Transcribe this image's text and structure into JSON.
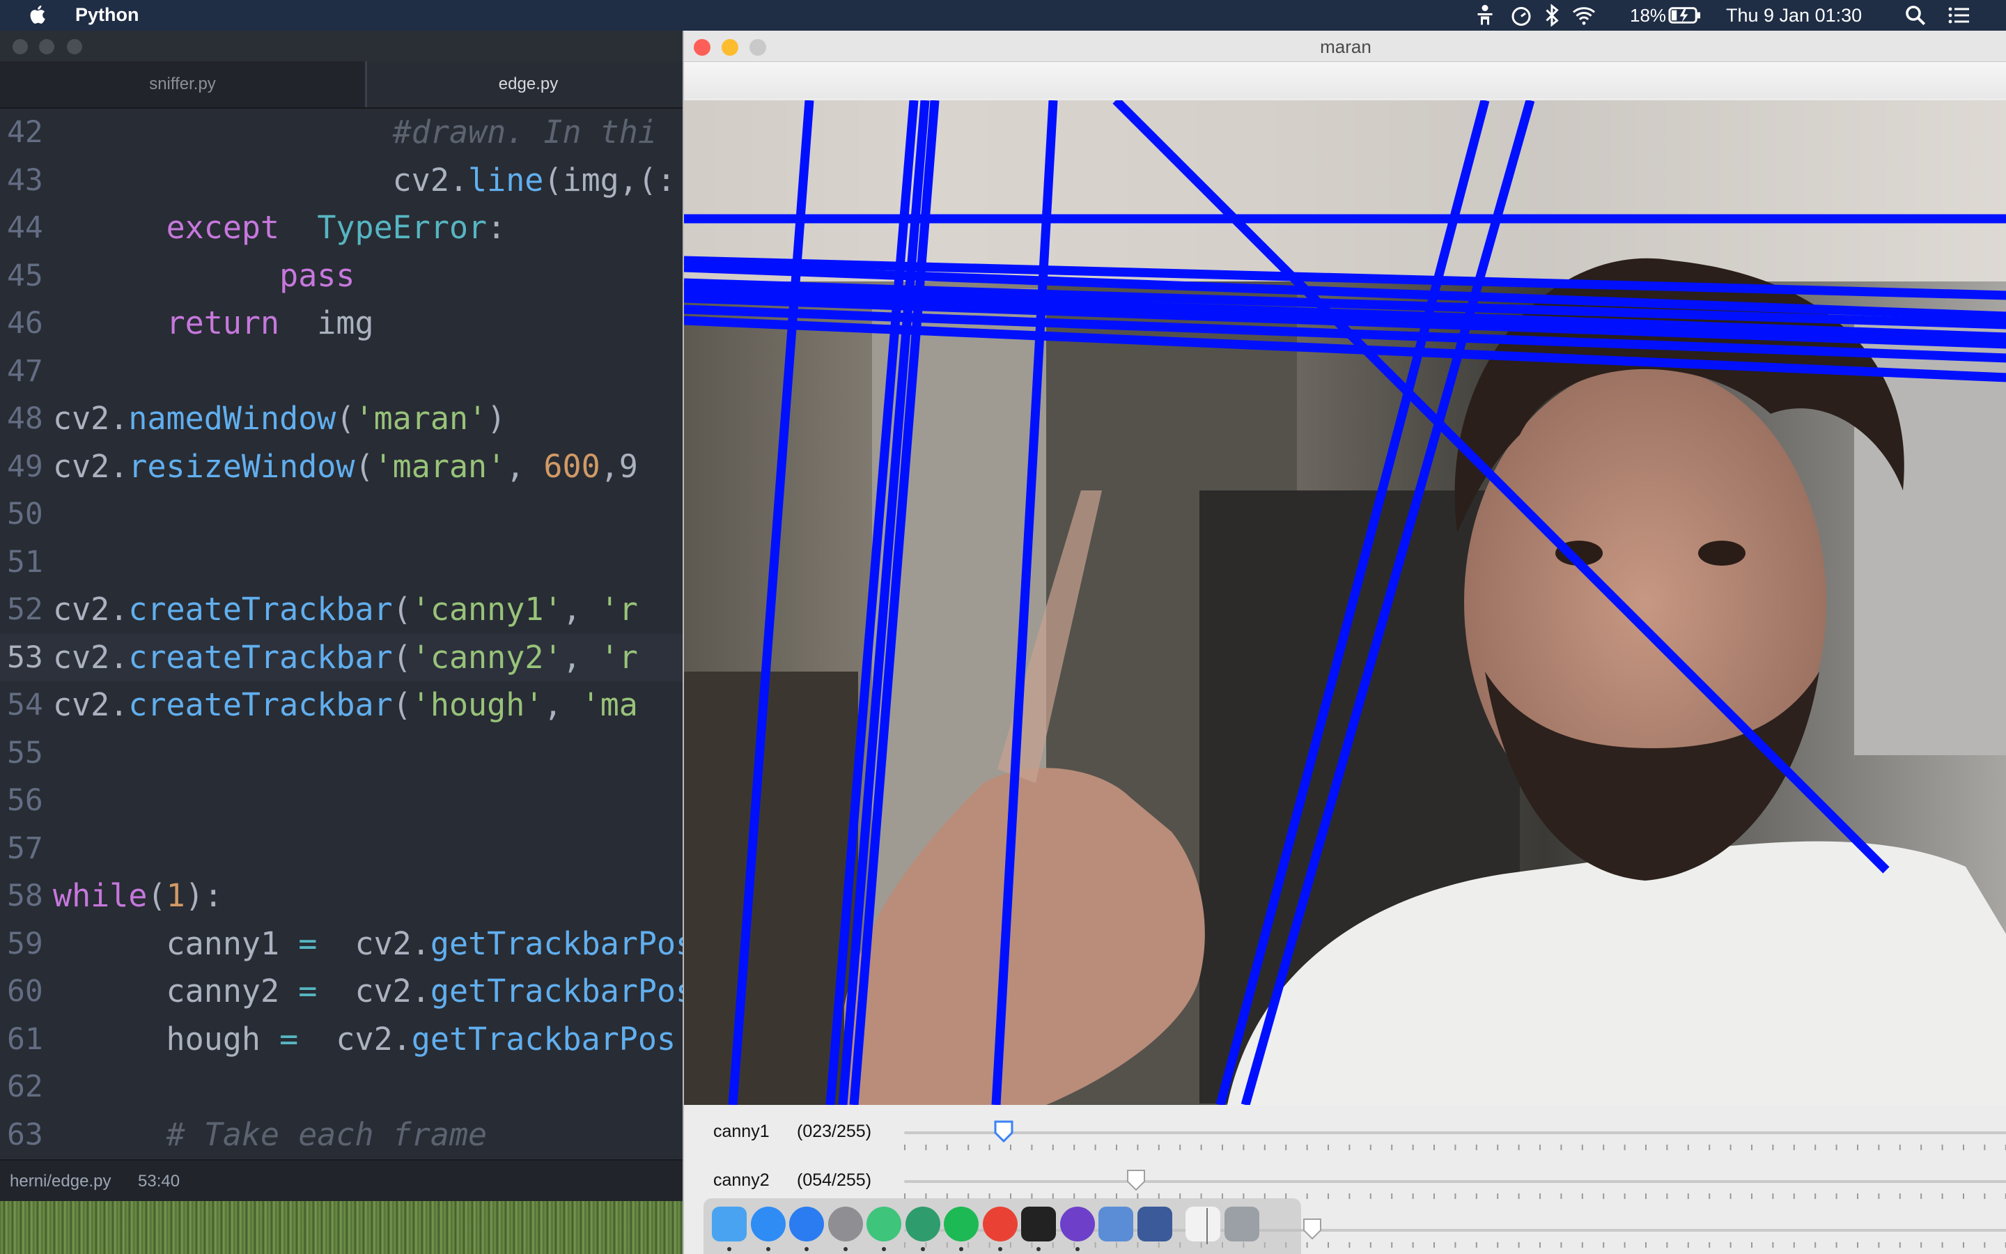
{
  "menubar": {
    "app_name": "Python",
    "battery": "18%",
    "clock": "Thu 9 Jan  01:30"
  },
  "editor": {
    "tabs": [
      {
        "label": "sniffer.py",
        "active": false
      },
      {
        "label": "edge.py",
        "active": true
      }
    ],
    "lines": [
      {
        "num": "42",
        "segments": [
          {
            "t": "         "
          },
          {
            "t": "#drawn. In thi",
            "c": "cm"
          }
        ]
      },
      {
        "num": "43",
        "segments": [
          {
            "t": "         cv2."
          },
          {
            "t": "line",
            "c": "fn"
          },
          {
            "t": "(img,(:"
          }
        ]
      },
      {
        "num": "44",
        "segments": [
          {
            "t": "   "
          },
          {
            "t": "except",
            "c": "kw"
          },
          {
            "t": " "
          },
          {
            "t": "TypeError",
            "c": "ty"
          },
          {
            "t": ":"
          }
        ]
      },
      {
        "num": "45",
        "segments": [
          {
            "t": "      "
          },
          {
            "t": "pass",
            "c": "kw"
          }
        ]
      },
      {
        "num": "46",
        "segments": [
          {
            "t": "   "
          },
          {
            "t": "return",
            "c": "kw"
          },
          {
            "t": " img"
          }
        ]
      },
      {
        "num": "47",
        "segments": []
      },
      {
        "num": "48",
        "segments": [
          {
            "t": "cv2."
          },
          {
            "t": "namedWindow",
            "c": "fn"
          },
          {
            "t": "("
          },
          {
            "t": "'maran'",
            "c": "st"
          },
          {
            "t": ")"
          }
        ]
      },
      {
        "num": "49",
        "segments": [
          {
            "t": "cv2."
          },
          {
            "t": "resizeWindow",
            "c": "fn"
          },
          {
            "t": "("
          },
          {
            "t": "'maran'",
            "c": "st"
          },
          {
            "t": ", "
          },
          {
            "t": "600",
            "c": "nm"
          },
          {
            "t": ",9"
          }
        ]
      },
      {
        "num": "50",
        "segments": []
      },
      {
        "num": "51",
        "segments": []
      },
      {
        "num": "52",
        "segments": [
          {
            "t": "cv2."
          },
          {
            "t": "createTrackbar",
            "c": "fn"
          },
          {
            "t": "("
          },
          {
            "t": "'canny1'",
            "c": "st"
          },
          {
            "t": ", "
          },
          {
            "t": "'r",
            "c": "st"
          }
        ]
      },
      {
        "num": "53",
        "segments": [
          {
            "t": "cv2."
          },
          {
            "t": "createTrackbar",
            "c": "fn"
          },
          {
            "t": "("
          },
          {
            "t": "'canny2'",
            "c": "st"
          },
          {
            "t": ", "
          },
          {
            "t": "'r",
            "c": "st"
          }
        ]
      },
      {
        "num": "54",
        "segments": [
          {
            "t": "cv2."
          },
          {
            "t": "createTrackbar",
            "c": "fn"
          },
          {
            "t": "("
          },
          {
            "t": "'hough'",
            "c": "st"
          },
          {
            "t": ", "
          },
          {
            "t": "'ma",
            "c": "st"
          }
        ]
      },
      {
        "num": "55",
        "segments": []
      },
      {
        "num": "56",
        "segments": []
      },
      {
        "num": "57",
        "segments": []
      },
      {
        "num": "58",
        "segments": [
          {
            "t": "while",
            "c": "kw"
          },
          {
            "t": "("
          },
          {
            "t": "1",
            "c": "nm"
          },
          {
            "t": "):"
          }
        ]
      },
      {
        "num": "59",
        "segments": [
          {
            "t": "   canny1 "
          },
          {
            "t": "=",
            "c": "op"
          },
          {
            "t": " cv2."
          },
          {
            "t": "getTrackbarPos",
            "c": "fn"
          }
        ]
      },
      {
        "num": "60",
        "segments": [
          {
            "t": "   canny2 "
          },
          {
            "t": "=",
            "c": "op"
          },
          {
            "t": " cv2."
          },
          {
            "t": "getTrackbarPos",
            "c": "fn"
          }
        ]
      },
      {
        "num": "61",
        "segments": [
          {
            "t": "   hough "
          },
          {
            "t": "=",
            "c": "op"
          },
          {
            "t": " cv2."
          },
          {
            "t": "getTrackbarPos",
            "c": "fn"
          }
        ]
      },
      {
        "num": "62",
        "segments": []
      },
      {
        "num": "63",
        "segments": [
          {
            "t": "   "
          },
          {
            "t": "# Take each frame",
            "c": "cm"
          }
        ]
      }
    ],
    "current_line": "53",
    "status_path": "herni/edge.py",
    "status_pos": "53:40"
  },
  "cv_window": {
    "title": "maran",
    "trackbars": [
      {
        "name": "canny1",
        "value": "(023/255)",
        "level": 0.09
      },
      {
        "name": "canny2",
        "value": "(054/255)",
        "level": 0.21
      },
      {
        "name": "",
        "value": "",
        "level": 0.37
      }
    ]
  },
  "dock": {
    "icons": [
      "finder-icon",
      "safari-icon",
      "app-store-icon",
      "system-preferences-icon",
      "time-machine-icon",
      "atom-icon",
      "spotify-icon",
      "chrome-icon",
      "terminal-icon",
      "github-icon",
      "preview-icon",
      "python-launcher-icon",
      "documents-icon",
      "trash-icon"
    ]
  },
  "colors": {
    "hough_line": "#0010ff",
    "editor_bg": "#282c34",
    "menubar_bg": "#1f2d45"
  }
}
